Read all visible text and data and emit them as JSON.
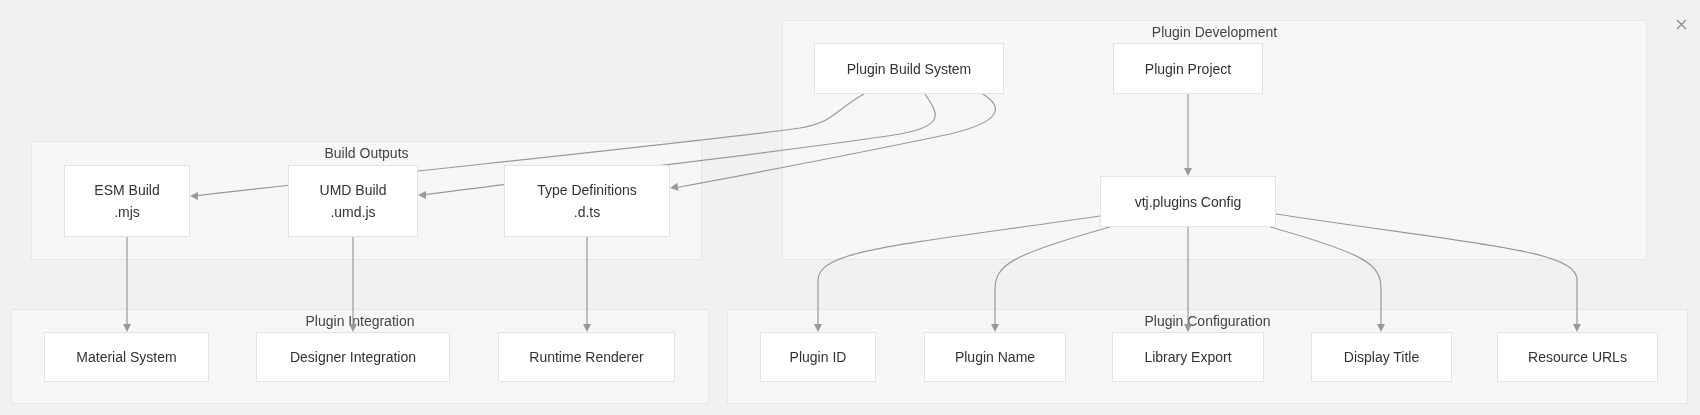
{
  "groups": [
    {
      "title": "Plugin Development",
      "nodes": [
        {
          "lines": [
            "Plugin Build System"
          ]
        },
        {
          "lines": [
            "Plugin Project"
          ]
        },
        {
          "lines": [
            "vtj.plugins Config"
          ]
        }
      ]
    },
    {
      "title": "Build Outputs",
      "nodes": [
        {
          "lines": [
            "ESM Build",
            ".mjs"
          ]
        },
        {
          "lines": [
            "UMD Build",
            ".umd.js"
          ]
        },
        {
          "lines": [
            "Type Definitions",
            ".d.ts"
          ]
        }
      ]
    },
    {
      "title": "Plugin Integration",
      "nodes": [
        {
          "lines": [
            "Material System"
          ]
        },
        {
          "lines": [
            "Designer Integration"
          ]
        },
        {
          "lines": [
            "Runtime Renderer"
          ]
        }
      ]
    },
    {
      "title": "Plugin Configuration",
      "nodes": [
        {
          "lines": [
            "Plugin ID"
          ]
        },
        {
          "lines": [
            "Plugin Name"
          ]
        },
        {
          "lines": [
            "Library Export"
          ]
        },
        {
          "lines": [
            "Display Title"
          ]
        },
        {
          "lines": [
            "Resource URLs"
          ]
        }
      ]
    }
  ]
}
